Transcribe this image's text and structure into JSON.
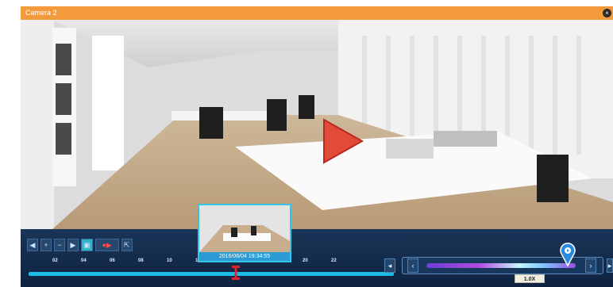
{
  "window": {
    "title": "Camera 2"
  },
  "toolbar": {
    "buttons": [
      {
        "name": "prev-button",
        "glyph": "◀"
      },
      {
        "name": "zoom-in-button",
        "glyph": "+"
      },
      {
        "name": "zoom-out-button",
        "glyph": "−"
      },
      {
        "name": "next-button",
        "glyph": "▶"
      },
      {
        "name": "snapshot-button",
        "glyph": "▣"
      },
      {
        "name": "record-button",
        "glyph": "●▶"
      },
      {
        "name": "export-button",
        "glyph": "⇱"
      }
    ]
  },
  "timeline": {
    "ticks": [
      "02",
      "04",
      "06",
      "08",
      "10",
      "12",
      "20",
      "22"
    ],
    "thumbnail_timestamp": "2016/06/04 19:34:55"
  },
  "speed": {
    "label": "1.0X",
    "level": 0.72
  },
  "colors": {
    "titlebar": "#f39b3c",
    "accent": "#1bbde4",
    "panel": "#1a3558"
  }
}
